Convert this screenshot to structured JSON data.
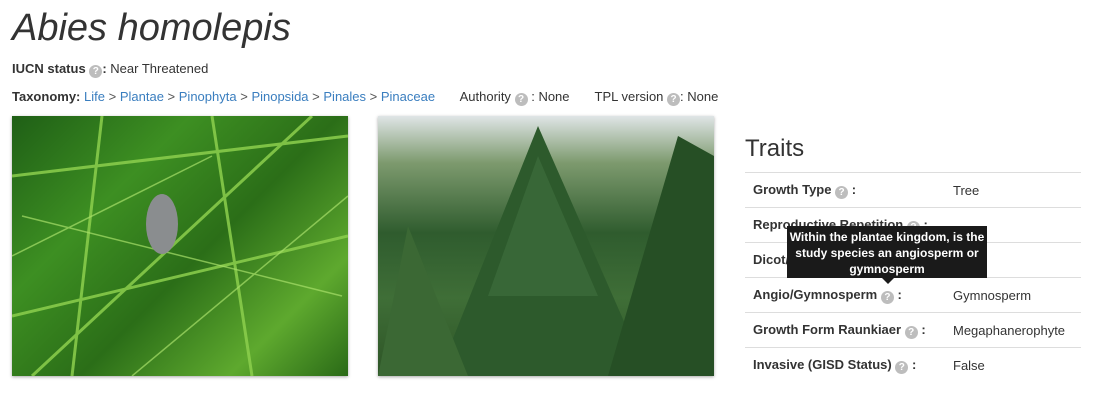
{
  "species": {
    "name": "Abies homolepis"
  },
  "iucn": {
    "label": "IUCN status",
    "value": "Near Threatened"
  },
  "taxonomy": {
    "label": "Taxonomy:",
    "path": [
      "Life",
      "Plantae",
      "Pinophyta",
      "Pinopsida",
      "Pinales",
      "Pinaceae"
    ],
    "separator": ">",
    "authority_label": "Authority",
    "authority_value": "None",
    "tpl_label": "TPL version",
    "tpl_value": "None"
  },
  "help_glyph": "?",
  "colon": ":",
  "images": [
    {
      "name": "photo-branch-with-cone"
    },
    {
      "name": "photo-fir-tree"
    }
  ],
  "traits": {
    "title": "Traits",
    "rows": [
      {
        "label": "Growth Type",
        "value": "Tree"
      },
      {
        "label": "Reproductive Repetition",
        "value": ""
      },
      {
        "label": "Dicot/Monocot",
        "value": ""
      },
      {
        "label": "Angio/Gymnosperm",
        "value": "Gymnosperm"
      },
      {
        "label": "Growth Form Raunkiaer",
        "value": "Megaphanerophyte"
      },
      {
        "label": "Invasive (GISD Status)",
        "value": "False"
      }
    ]
  },
  "tooltip": {
    "text": "Within the plantae kingdom, is the study species an angiosperm or gymnosperm"
  },
  "colors": {
    "link": "#3a7ebf",
    "tooltip_bg": "#1a1a1a",
    "help_icon": "#bdbdbd"
  }
}
